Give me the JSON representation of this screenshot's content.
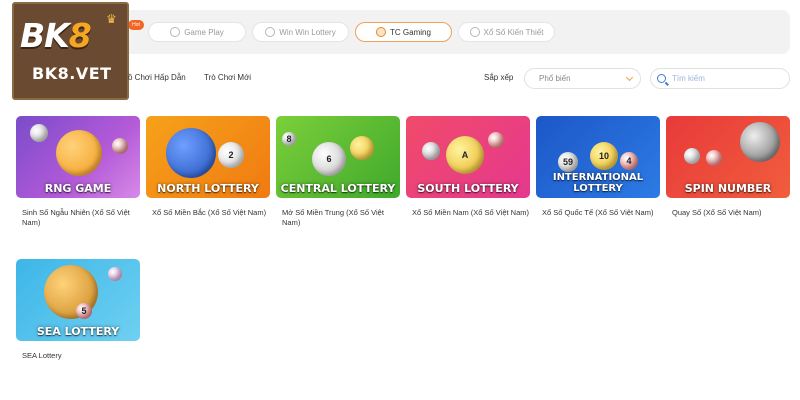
{
  "logo": {
    "main_text_1": "BK",
    "main_text_2": "8",
    "sub_text": "BK8.VET"
  },
  "provider_tabs": {
    "hot_badge": "Hot",
    "items": [
      {
        "label": "Game Play",
        "icon": "gameplay-icon",
        "active": false
      },
      {
        "label": "Win Win Lottery",
        "icon": "winwin-icon",
        "active": false
      },
      {
        "label": "TC Gaming",
        "icon": "tcgaming-icon",
        "active": true
      },
      {
        "label": "Xổ Số Kiến Thiết",
        "icon": "kienthiet-icon",
        "active": false
      }
    ]
  },
  "filters": {
    "items": [
      "ồ Chơi Hấp Dẫn",
      "Trò Chơi Mới"
    ]
  },
  "sort": {
    "label": "Sắp xếp",
    "value": "Phổ biến"
  },
  "search": {
    "placeholder": "Tìm kiếm"
  },
  "games": [
    {
      "title": "RNG GAME",
      "name": "Sinh Số Ngẫu Nhiên (Xổ Số Việt Nam)"
    },
    {
      "title": "NORTH LOTTERY",
      "name": "Xổ Số Miền Bắc (Xổ Số Việt Nam)"
    },
    {
      "title": "CENTRAL LOTTERY",
      "name": "Mở Số Miền Trung (Xổ Số Việt Nam)"
    },
    {
      "title": "SOUTH LOTTERY",
      "name": "Xổ Số Miền Nam (Xổ Số Việt Nam)"
    },
    {
      "title": "INTERNATIONAL LOTTERY",
      "name": "Xổ Số Quốc Tế (Xổ Số Việt Nam)"
    },
    {
      "title": "SPIN NUMBER",
      "name": "Quay Số (Xổ Số Việt Nam)"
    },
    {
      "title": "SEA LOTTERY",
      "name": "SEA Lottery"
    }
  ],
  "ball_numbers": {
    "north_1": "2",
    "central_1": "6",
    "central_2": "8",
    "south_1": "A",
    "intl_1": "10",
    "intl_2": "59",
    "intl_3": "4",
    "sea_1": "5"
  }
}
